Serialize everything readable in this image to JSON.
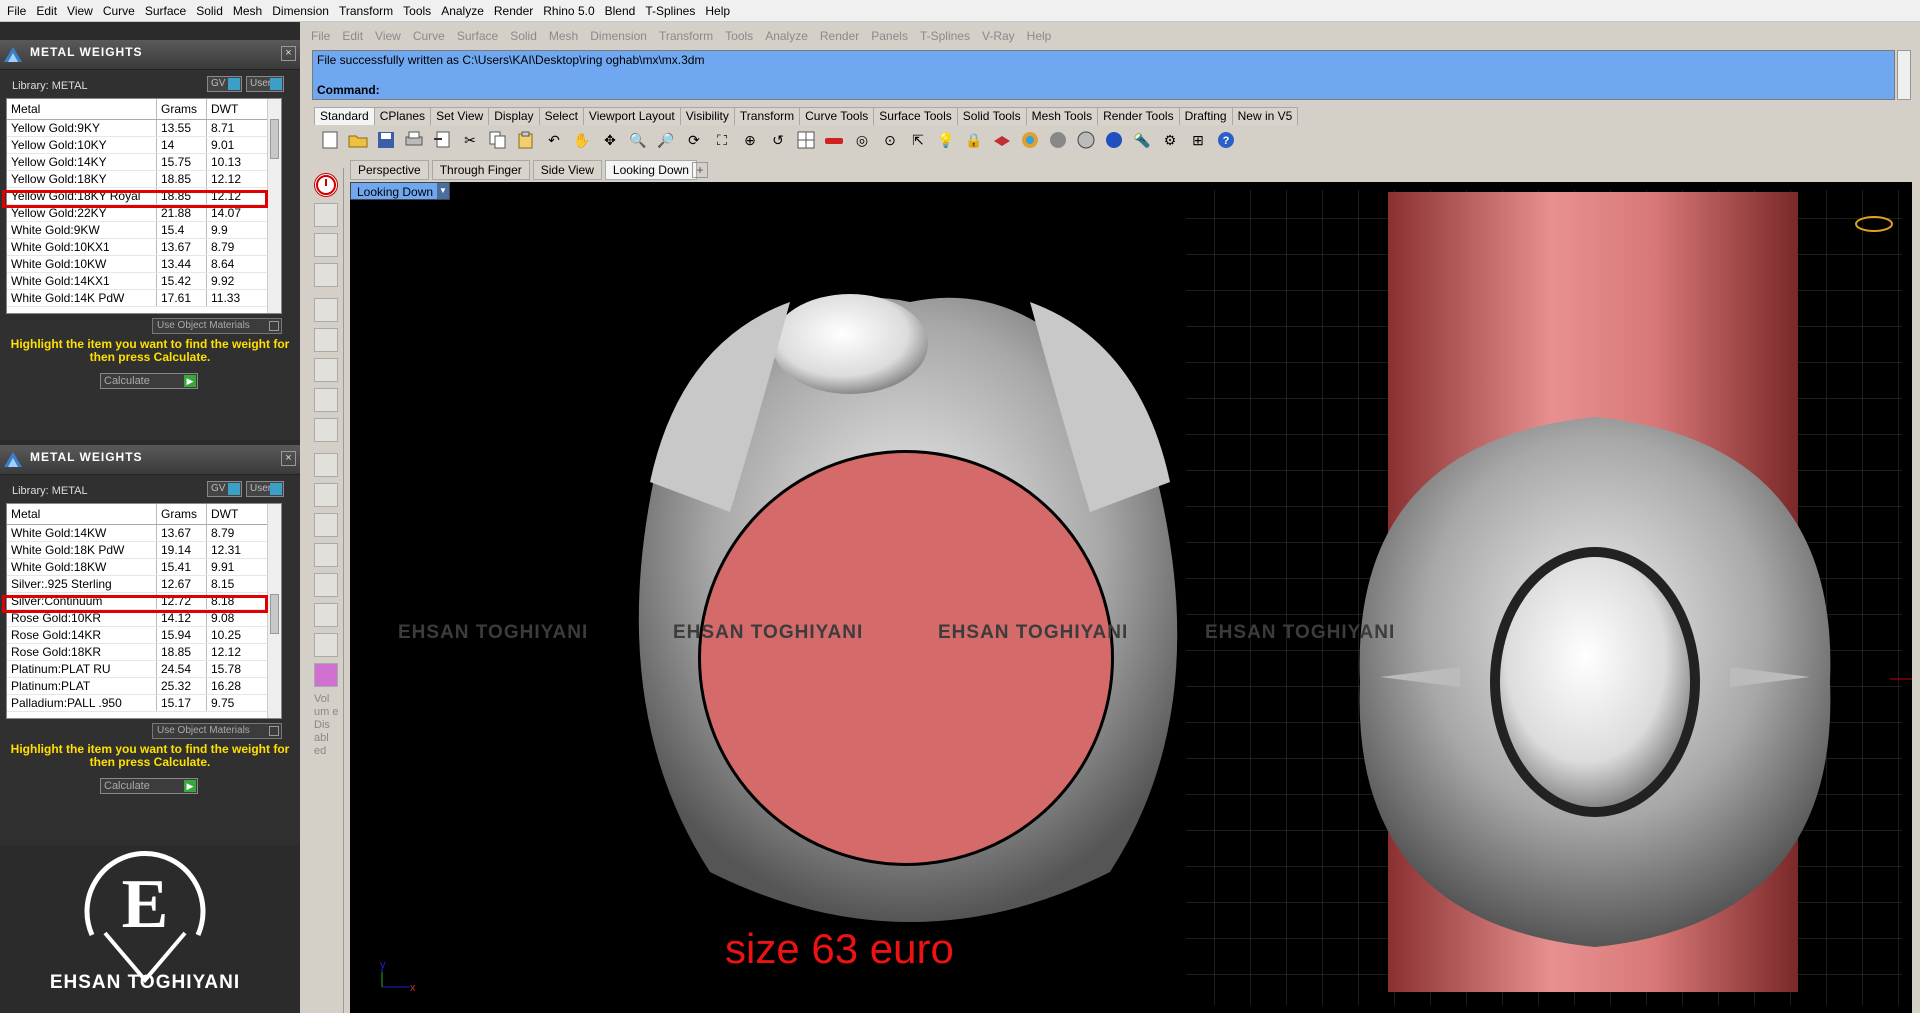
{
  "top_menu": [
    "File",
    "Edit",
    "View",
    "Curve",
    "Surface",
    "Solid",
    "Mesh",
    "Dimension",
    "Transform",
    "Tools",
    "Analyze",
    "Render",
    "Rhino 5.0",
    "Blend",
    "T-Splines",
    "Help"
  ],
  "panel1": {
    "title": "METAL WEIGHTS",
    "library": "Library: METAL",
    "toggle_gv": "GV",
    "toggle_user": "User",
    "headers": [
      "Metal",
      "Grams",
      "DWT"
    ],
    "rows": [
      [
        "Yellow Gold:9KY",
        "13.55",
        "8.71"
      ],
      [
        "Yellow Gold:10KY",
        "14",
        "9.01"
      ],
      [
        "Yellow Gold:14KY",
        "15.75",
        "10.13"
      ],
      [
        "Yellow Gold:18KY",
        "18.85",
        "12.12"
      ],
      [
        "Yellow Gold:18KY Royal",
        "18.85",
        "12.12"
      ],
      [
        "Yellow Gold:22KY",
        "21.88",
        "14.07"
      ],
      [
        "White Gold:9KW",
        "15.4",
        "9.9"
      ],
      [
        "White Gold:10KX1",
        "13.67",
        "8.79"
      ],
      [
        "White Gold:10KW",
        "13.44",
        "8.64"
      ],
      [
        "White Gold:14KX1",
        "15.42",
        "9.92"
      ],
      [
        "White Gold:14K PdW",
        "17.61",
        "11.33"
      ]
    ],
    "use_object": "Use Object Materials",
    "hint": "Highlight the item you want to find the weight for then press Calculate.",
    "calculate": "Calculate"
  },
  "panel2": {
    "title": "METAL WEIGHTS",
    "library": "Library: METAL",
    "toggle_gv": "GV",
    "toggle_user": "User",
    "headers": [
      "Metal",
      "Grams",
      "DWT"
    ],
    "rows": [
      [
        "White Gold:14KW",
        "13.67",
        "8.79"
      ],
      [
        "White Gold:18K PdW",
        "19.14",
        "12.31"
      ],
      [
        "White Gold:18KW",
        "15.41",
        "9.91"
      ],
      [
        "Silver:.925 Sterling",
        "12.67",
        "8.15"
      ],
      [
        "Silver:Continuum",
        "12.72",
        "8.18"
      ],
      [
        "Rose Gold:10KR",
        "14.12",
        "9.08"
      ],
      [
        "Rose Gold:14KR",
        "15.94",
        "10.25"
      ],
      [
        "Rose Gold:18KR",
        "18.85",
        "12.12"
      ],
      [
        "Platinum:PLAT RU",
        "24.54",
        "15.78"
      ],
      [
        "Platinum:PLAT",
        "25.32",
        "16.28"
      ],
      [
        "Palladium:PALL .950",
        "15.17",
        "9.75"
      ]
    ],
    "use_object": "Use Object Materials",
    "hint": "Highlight the item you want to find the weight for then press Calculate.",
    "calculate": "Calculate"
  },
  "brand": {
    "logo_letter": "E",
    "name": "EHSAN TOGHIYANI"
  },
  "rhino_menu": [
    "File",
    "Edit",
    "View",
    "Curve",
    "Surface",
    "Solid",
    "Mesh",
    "Dimension",
    "Transform",
    "Tools",
    "Analyze",
    "Render",
    "Panels",
    "T-Splines",
    "V-Ray",
    "Help"
  ],
  "command": {
    "message": "File successfully written as C:\\Users\\KAI\\Desktop\\ring oghab\\mx\\mx.3dm",
    "prompt": "Command:"
  },
  "toolbar_tabs": [
    "Standard",
    "CPlanes",
    "Set View",
    "Display",
    "Select",
    "Viewport Layout",
    "Visibility",
    "Transform",
    "Curve Tools",
    "Surface Tools",
    "Solid Tools",
    "Mesh Tools",
    "Render Tools",
    "Drafting",
    "New in V5"
  ],
  "viewport_tabs": [
    "Perspective",
    "Through Finger",
    "Side View",
    "Looking Down"
  ],
  "viewport_add": "+",
  "active_viewport": "Looking Down",
  "side_text": "Vol um e Dis abl ed",
  "watermark_text": "EHSAN TOGHIYANI",
  "axis_x": "x",
  "axis_y": "y",
  "size_label": "size 63 euro",
  "colors": {
    "highlight_red": "#e00000",
    "command_blue": "#6fa8f0",
    "hint_yellow": "#ffe000",
    "size_text": "#ee1212",
    "cylinder": "#c86060"
  }
}
